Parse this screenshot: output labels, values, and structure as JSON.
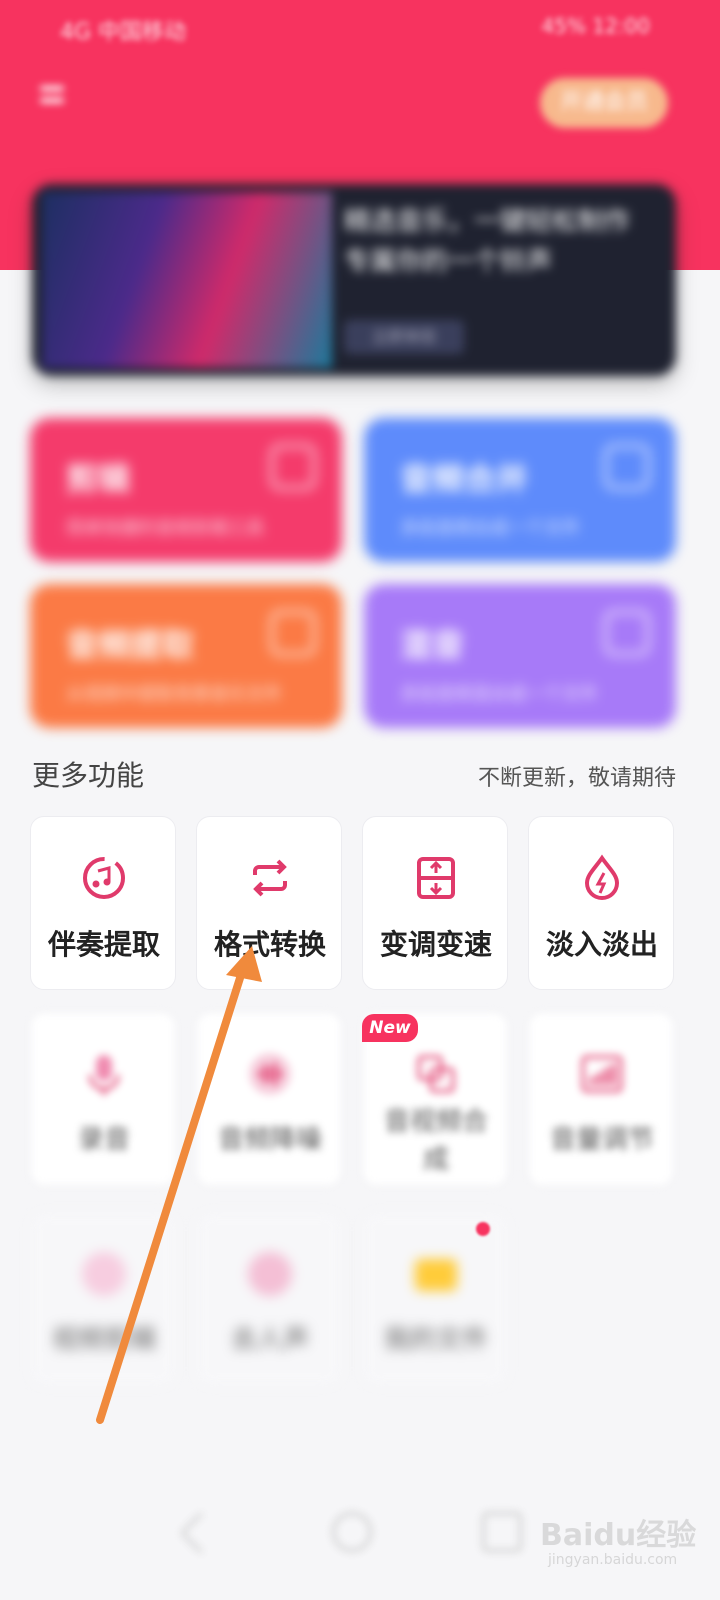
{
  "status_bar": {
    "left": "4G 中国移动",
    "right": "45% 12:00"
  },
  "header": {
    "vip_label": "开通会员"
  },
  "banner": {
    "title": "精选音乐，一键轻松制作专属你的一个铃声",
    "button": "立即体验"
  },
  "feature_cards": [
    {
      "title": "剪辑",
      "subtitle": "简单快捷的音频剪辑工具",
      "color": "#f43b6b"
    },
    {
      "title": "音频合并",
      "subtitle": "多段音频合成一个文件",
      "color": "#5e8bfb"
    },
    {
      "title": "音频提取",
      "subtitle": "从视频中提取背景音乐文件",
      "color": "#fb7a45"
    },
    {
      "title": "混音",
      "subtitle": "多段音频混合成一个文件",
      "color": "#a77af8"
    }
  ],
  "section": {
    "title": "更多功能",
    "note": "不断更新，敬请期待"
  },
  "tools_row1": [
    {
      "label": "伴奏提取",
      "icon": "music-extract-icon"
    },
    {
      "label": "格式转换",
      "icon": "convert-icon"
    },
    {
      "label": "变调变速",
      "icon": "pitch-speed-icon"
    },
    {
      "label": "淡入淡出",
      "icon": "fade-icon"
    }
  ],
  "tools_row2": [
    {
      "label": "录音",
      "icon": "microphone-icon"
    },
    {
      "label": "音频降噪",
      "icon": "waveform-icon"
    },
    {
      "label": "音视频合成",
      "icon": "video-merge-icon",
      "badge": "New"
    },
    {
      "label": "音量调节",
      "icon": "volume-chart-icon"
    }
  ],
  "tools_row3": [
    {
      "label": "视频剪辑",
      "icon": "video-edit-icon"
    },
    {
      "label": "去人声",
      "icon": "remove-vocal-icon"
    },
    {
      "label": "我的文件",
      "icon": "folder-icon"
    }
  ],
  "watermark": {
    "main": "Baidu经验",
    "sub": "jingyan.baidu.com"
  },
  "colors": {
    "brand": "#f7335f",
    "icon": "#e03a6b",
    "arrow": "#f08a3c"
  }
}
